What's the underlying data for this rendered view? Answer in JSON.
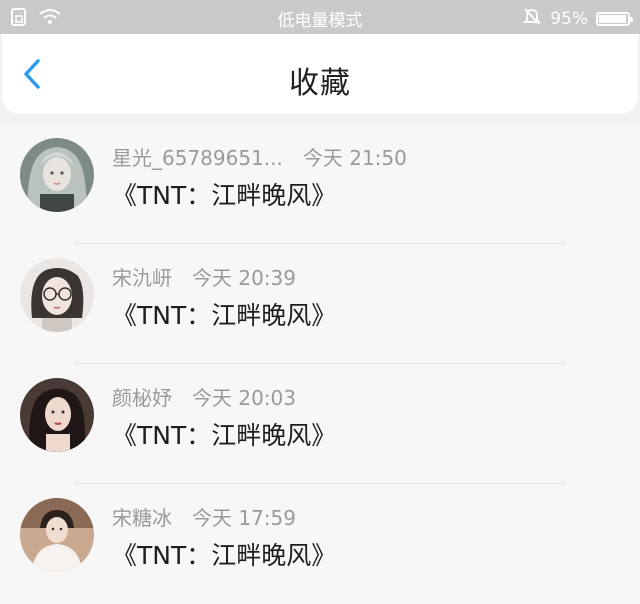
{
  "status_bar": {
    "mode_text": "低电量模式",
    "battery_percent_text": "95%",
    "battery_level": 0.95,
    "icons": [
      "sim-card-icon",
      "wifi-icon",
      "bell-muted-icon",
      "battery-icon"
    ]
  },
  "header": {
    "title": "收藏",
    "back_icon": "chevron-left-icon",
    "accent_color": "#2d9cf0"
  },
  "favorites": [
    {
      "name": "星光_65789651...",
      "time": "今天 21:50",
      "message": "《TNT：江畔晚风》"
    },
    {
      "name": "宋氿岍",
      "time": "今天 20:39",
      "message": "《TNT：江畔晚风》"
    },
    {
      "name": "颜柲妤",
      "time": "今天 20:03",
      "message": "《TNT：江畔晚风》"
    },
    {
      "name": "宋糖冰",
      "time": "今天 17:59",
      "message": "《TNT：江畔晚风》"
    }
  ]
}
